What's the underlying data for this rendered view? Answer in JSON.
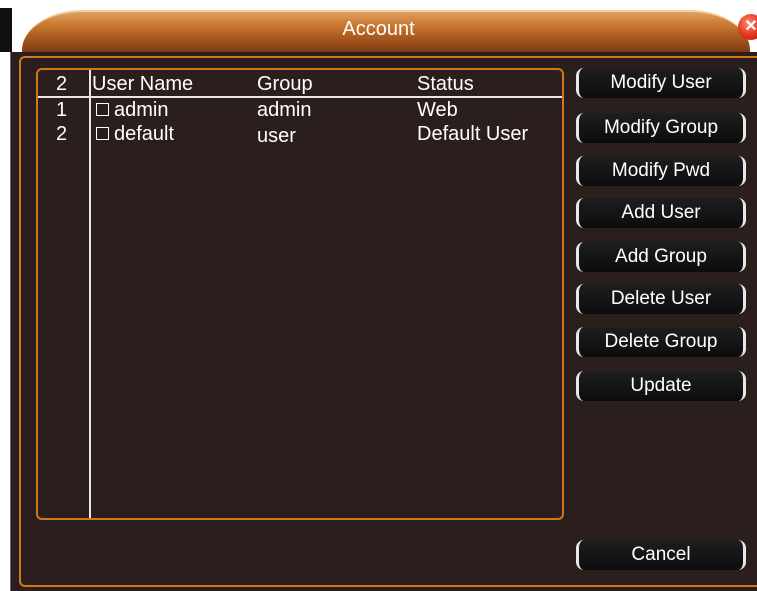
{
  "window": {
    "title": "Account",
    "close_glyph": "✕",
    "close_icon": "close-icon",
    "accent_color": "#d4761c",
    "title_color": "#c87830"
  },
  "table": {
    "headers": {
      "count": "2",
      "user_name": "User Name",
      "group": "Group",
      "status": "Status"
    },
    "rows": [
      {
        "index": "1",
        "user_name": "admin",
        "group": "admin",
        "status": "Web",
        "checked": false
      },
      {
        "index": "2",
        "user_name": "default",
        "group": "user",
        "status": "Default User",
        "checked": false
      }
    ]
  },
  "buttons": {
    "modify_user": "Modify User",
    "modify_group": "Modify Group",
    "modify_pwd": "Modify Pwd",
    "add_user": "Add User",
    "add_group": "Add Group",
    "delete_user": "Delete User",
    "delete_group": "Delete Group",
    "update": "Update",
    "cancel": "Cancel"
  }
}
